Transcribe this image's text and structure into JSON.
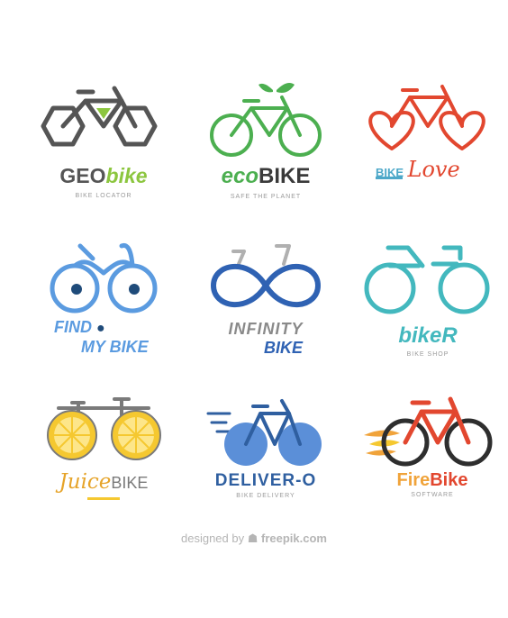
{
  "logos": [
    {
      "id": "geobike",
      "brand_a": "GEO",
      "brand_b": "bike",
      "tagline": "BIKE LOCATOR",
      "colors": {
        "frame": "#555555",
        "accent": "#8cc63f"
      }
    },
    {
      "id": "ecobike",
      "brand_a": "eco",
      "brand_b": "BIKE",
      "tagline": "SAFE THE PLANET",
      "colors": {
        "frame": "#4caf50",
        "text": "#3a3a3a"
      }
    },
    {
      "id": "bikelove",
      "brand_a": "BIKE",
      "brand_b": "Love",
      "colors": {
        "frame": "#e2472f",
        "accent": "#4da8c9"
      }
    },
    {
      "id": "findmybike",
      "brand_a": "FIND",
      "brand_b": "MY BIKE",
      "colors": {
        "frame": "#5b9be0",
        "eye": "#1f4b7a"
      }
    },
    {
      "id": "infinitybike",
      "brand_a": "INFINITY",
      "brand_b": "BIKE",
      "colors": {
        "frame": "#2f62b3",
        "bar": "#b0b0b0",
        "text": "#8a8a8a"
      }
    },
    {
      "id": "biker",
      "brand_a": "bikeR",
      "tagline": "BIKE SHOP",
      "colors": {
        "frame": "#43b8be"
      }
    },
    {
      "id": "juicebike",
      "brand_a": "Juice",
      "brand_b": "BIKE",
      "colors": {
        "wheel": "#f5c830",
        "frame": "#7a7a7a",
        "text": "#e6a42a"
      }
    },
    {
      "id": "delivero",
      "brand_a": "DELIVER-O",
      "tagline": "BIKE DELIVERY",
      "colors": {
        "frame": "#2f5fa0",
        "wheel": "#5b8fd8"
      }
    },
    {
      "id": "firebike",
      "brand_a": "Fire",
      "brand_b": "Bike",
      "tagline": "SOFTWARE",
      "colors": {
        "frame": "#e2472f",
        "wheel": "#2e2e2e",
        "flame": "#f0a33a"
      }
    }
  ],
  "footer": {
    "prefix": "designed by",
    "brand": "freepik.com"
  }
}
